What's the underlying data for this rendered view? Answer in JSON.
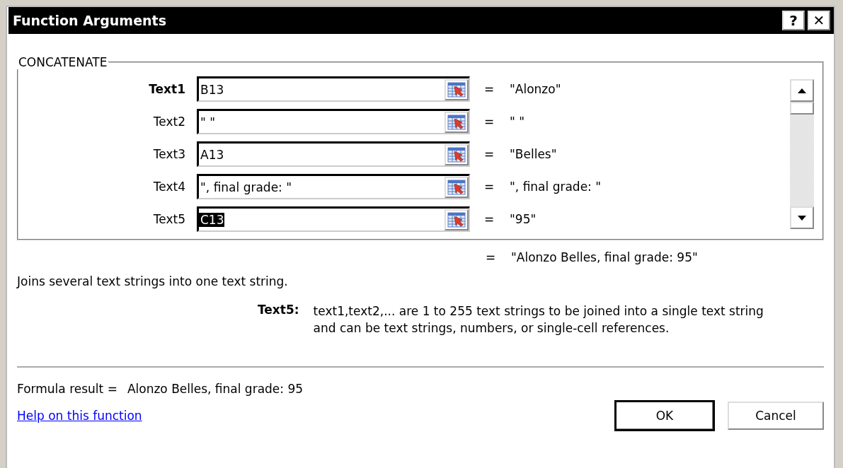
{
  "window": {
    "title": "Function Arguments",
    "buttons": [
      "?",
      "✕"
    ]
  },
  "function_group": {
    "title": "CONCATENATE",
    "arguments": [
      {
        "label": "Text1",
        "required": true,
        "value": "B13",
        "value_selected": false,
        "result": "\"Alonzo\""
      },
      {
        "label": "Text2",
        "required": false,
        "value": "\" \"",
        "value_selected": false,
        "result": "\" \""
      },
      {
        "label": "Text3",
        "required": false,
        "value": "A13",
        "value_selected": false,
        "result": "\"Belles\""
      },
      {
        "label": "Text4",
        "required": false,
        "value": "\", final grade: \"",
        "value_selected": false,
        "result": "\", final grade: \""
      },
      {
        "label": "Text5",
        "required": false,
        "value": "C13",
        "value_selected": true,
        "result": "\"95\""
      }
    ]
  },
  "combined_result": {
    "sign": "=",
    "value": "\"Alonzo Belles, final grade: 95\""
  },
  "equals_sign": "=",
  "description": "Joins several text strings into one text string.",
  "argument_help": {
    "label": "Text5:",
    "lines": [
      "text1,text2,... are 1 to 255 text strings to be joined into a single text string",
      "and can be text strings, numbers, or single-cell references."
    ]
  },
  "formula_result": {
    "label": "Formula result =",
    "value": "Alonzo Belles, final grade: 95"
  },
  "help_link": "Help on this function",
  "buttons": [
    {
      "label": "OK",
      "default": true
    },
    {
      "label": "Cancel",
      "default": false
    }
  ]
}
